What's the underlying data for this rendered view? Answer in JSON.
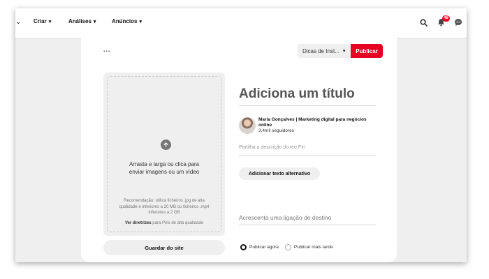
{
  "nav": {
    "items": [
      {
        "label": "Criar"
      },
      {
        "label": "Análises"
      },
      {
        "label": "Anúncios"
      }
    ],
    "notification_count": "48"
  },
  "pin": {
    "board_select": "Dicas de Inst...",
    "publish_label": "Publicar",
    "more_label": "...",
    "upload_text": "Arrasta e larga ou clica para enviar imagens ou um vídeo",
    "upload_recommendation": "Recomendação: utiliza ficheiros .jpg de alta qualidade e inferiores a 20 MB ou ficheiros .mp4 inferiores a 2 GB",
    "guidelines_link": "Ver diretrizes",
    "guidelines_suffix": " para Pins de alta qualidade",
    "save_from_site": "Guardar do site",
    "title_placeholder": "Adiciona um título",
    "author_name": "Maria Gonçalves | Marketing digital para negócios online",
    "author_followers": "3,4mil seguidores",
    "description_placeholder": "Partilha a descrição do teu Pin",
    "alt_text_button": "Adicionar texto alternativo",
    "link_placeholder": "Acrescenta uma ligação de destino",
    "publish_now": "Publicar agora",
    "publish_later": "Publicar mais tarde"
  },
  "colors": {
    "brand_red": "#e60023",
    "background": "#efefef"
  }
}
